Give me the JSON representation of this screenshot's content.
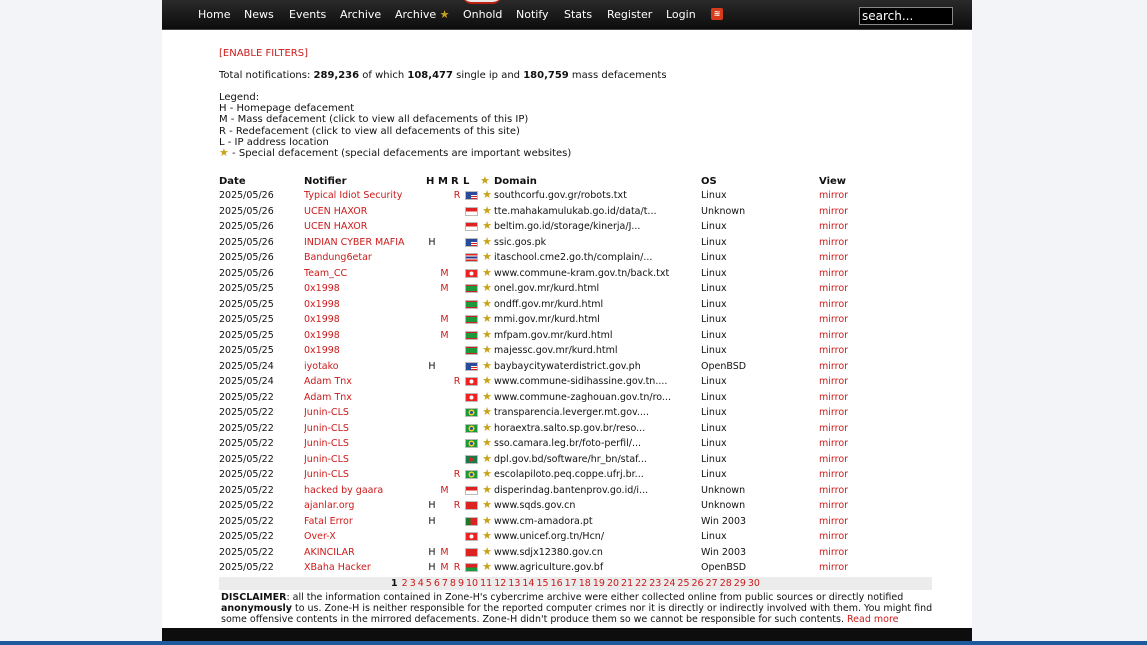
{
  "nav": {
    "items": [
      "Home",
      "News",
      "Events",
      "Archive",
      "Archive",
      "Onhold",
      "Notify",
      "Stats",
      "Register",
      "Login"
    ],
    "search_placeholder": "search...",
    "rss_icon": "rss-icon",
    "special_icon": "star-icon"
  },
  "filters_label": "[ENABLE FILTERS]",
  "totals": {
    "prefix": "Total notifications: ",
    "total": "289,236",
    "mid1": " of which ",
    "single": "108,477",
    "mid2": " single ip and ",
    "mass": "180,759",
    "suffix": " mass defacements"
  },
  "legend": {
    "title": "Legend:",
    "h": "H - Homepage defacement",
    "m": "M - Mass defacement (click to view all defacements of this IP)",
    "r": "R - Redefacement (click to view all defacements of this site)",
    "l": "L - IP address location",
    "star": " - Special defacement (special defacements are important websites)"
  },
  "table": {
    "headers": {
      "date": "Date",
      "notifier": "Notifier",
      "h": "H",
      "m": "M",
      "r": "R",
      "l": "L",
      "domain": "Domain",
      "os": "OS",
      "view": "View"
    },
    "rows": [
      {
        "date": "2025/05/26",
        "notifier": "Typical Idiot Security",
        "h": "",
        "m": "",
        "r": "R",
        "flag": "us",
        "domain": "southcorfu.gov.gr/robots.txt",
        "os": "Linux",
        "view": "mirror"
      },
      {
        "date": "2025/05/26",
        "notifier": "UCEN HAXOR",
        "h": "",
        "m": "",
        "r": "",
        "flag": "id",
        "domain": "tte.mahakamulukab.go.id/data/t...",
        "os": "Unknown",
        "view": "mirror"
      },
      {
        "date": "2025/05/26",
        "notifier": "UCEN HAXOR",
        "h": "",
        "m": "",
        "r": "",
        "flag": "id",
        "domain": "beltim.go.id/storage/kinerja/J...",
        "os": "Linux",
        "view": "mirror"
      },
      {
        "date": "2025/05/26",
        "notifier": "INDIAN CYBER MAFIA",
        "h": "H",
        "m": "",
        "r": "",
        "flag": "us",
        "domain": "ssic.gos.pk",
        "os": "Linux",
        "view": "mirror"
      },
      {
        "date": "2025/05/26",
        "notifier": "Bandung6etar",
        "h": "",
        "m": "",
        "r": "",
        "flag": "th",
        "domain": "itaschool.cme2.go.th/complain/...",
        "os": "Linux",
        "view": "mirror"
      },
      {
        "date": "2025/05/26",
        "notifier": "Team_CC",
        "h": "",
        "m": "M",
        "r": "",
        "flag": "tn",
        "domain": "www.commune-kram.gov.tn/back.txt",
        "os": "Linux",
        "view": "mirror"
      },
      {
        "date": "2025/05/25",
        "notifier": "0x1998",
        "h": "",
        "m": "M",
        "r": "",
        "flag": "mr",
        "domain": "onel.gov.mr/kurd.html",
        "os": "Linux",
        "view": "mirror"
      },
      {
        "date": "2025/05/25",
        "notifier": "0x1998",
        "h": "",
        "m": "",
        "r": "",
        "flag": "mr",
        "domain": "ondff.gov.mr/kurd.html",
        "os": "Linux",
        "view": "mirror"
      },
      {
        "date": "2025/05/25",
        "notifier": "0x1998",
        "h": "",
        "m": "M",
        "r": "",
        "flag": "mr",
        "domain": "mmi.gov.mr/kurd.html",
        "os": "Linux",
        "view": "mirror"
      },
      {
        "date": "2025/05/25",
        "notifier": "0x1998",
        "h": "",
        "m": "M",
        "r": "",
        "flag": "mr",
        "domain": "mfpam.gov.mr/kurd.html",
        "os": "Linux",
        "view": "mirror"
      },
      {
        "date": "2025/05/25",
        "notifier": "0x1998",
        "h": "",
        "m": "",
        "r": "",
        "flag": "mr",
        "domain": "majessc.gov.mr/kurd.html",
        "os": "Linux",
        "view": "mirror"
      },
      {
        "date": "2025/05/24",
        "notifier": "iyotako",
        "h": "H",
        "m": "",
        "r": "",
        "flag": "us",
        "domain": "baybaycitywaterdistrict.gov.ph",
        "os": "OpenBSD",
        "view": "mirror"
      },
      {
        "date": "2025/05/24",
        "notifier": "Adam Tnx",
        "h": "",
        "m": "",
        "r": "R",
        "flag": "tn",
        "domain": "www.commune-sidihassine.gov.tn....",
        "os": "Linux",
        "view": "mirror"
      },
      {
        "date": "2025/05/22",
        "notifier": "Adam Tnx",
        "h": "",
        "m": "",
        "r": "",
        "flag": "tn",
        "domain": "www.commune-zaghouan.gov.tn/ro...",
        "os": "Linux",
        "view": "mirror"
      },
      {
        "date": "2025/05/22",
        "notifier": "Junin-CLS",
        "h": "",
        "m": "",
        "r": "",
        "flag": "br",
        "domain": "transparencia.leverger.mt.gov....",
        "os": "Linux",
        "view": "mirror"
      },
      {
        "date": "2025/05/22",
        "notifier": "Junin-CLS",
        "h": "",
        "m": "",
        "r": "",
        "flag": "br",
        "domain": "horaextra.salto.sp.gov.br/reso...",
        "os": "Linux",
        "view": "mirror"
      },
      {
        "date": "2025/05/22",
        "notifier": "Junin-CLS",
        "h": "",
        "m": "",
        "r": "",
        "flag": "br",
        "domain": "sso.camara.leg.br/foto-perfil/...",
        "os": "Linux",
        "view": "mirror"
      },
      {
        "date": "2025/05/22",
        "notifier": "Junin-CLS",
        "h": "",
        "m": "",
        "r": "",
        "flag": "bd",
        "domain": "dpl.gov.bd/software/hr_bn/staf...",
        "os": "Linux",
        "view": "mirror"
      },
      {
        "date": "2025/05/22",
        "notifier": "Junin-CLS",
        "h": "",
        "m": "",
        "r": "R",
        "flag": "br",
        "domain": "escolapiloto.peq.coppe.ufrj.br...",
        "os": "Linux",
        "view": "mirror"
      },
      {
        "date": "2025/05/22",
        "notifier": "hacked by gaara",
        "h": "",
        "m": "M",
        "r": "",
        "flag": "id",
        "domain": "disperindag.bantenprov.go.id/i...",
        "os": "Unknown",
        "view": "mirror"
      },
      {
        "date": "2025/05/22",
        "notifier": "ajanlar.org",
        "h": "H",
        "m": "",
        "r": "R",
        "flag": "cn",
        "domain": "www.sqds.gov.cn",
        "os": "Unknown",
        "view": "mirror"
      },
      {
        "date": "2025/05/22",
        "notifier": "Fatal Error",
        "h": "H",
        "m": "",
        "r": "",
        "flag": "pt",
        "domain": "www.cm-amadora.pt",
        "os": "Win 2003",
        "view": "mirror"
      },
      {
        "date": "2025/05/22",
        "notifier": "Over-X",
        "h": "",
        "m": "",
        "r": "",
        "flag": "tn",
        "domain": "www.unicef.org.tn/Hcn/",
        "os": "Linux",
        "view": "mirror"
      },
      {
        "date": "2025/05/22",
        "notifier": "AKINCILAR",
        "h": "H",
        "m": "M",
        "r": "",
        "flag": "cn",
        "domain": "www.sdjx12380.gov.cn",
        "os": "Win 2003",
        "view": "mirror"
      },
      {
        "date": "2025/05/22",
        "notifier": "XBaha Hacker",
        "h": "H",
        "m": "M",
        "r": "R",
        "flag": "bf",
        "domain": "www.agriculture.gov.bf",
        "os": "OpenBSD",
        "view": "mirror"
      }
    ]
  },
  "pager": {
    "current": "1",
    "pages": [
      "2",
      "3",
      "4",
      "5",
      "6",
      "7",
      "8",
      "9",
      "10",
      "11",
      "12",
      "13",
      "14",
      "15",
      "16",
      "17",
      "18",
      "19",
      "20",
      "21",
      "22",
      "23",
      "24",
      "25",
      "26",
      "27",
      "28",
      "29",
      "30"
    ]
  },
  "disclaimer": {
    "label": "DISCLAIMER",
    "text1": ": all the information contained in Zone-H's cybercrime archive were either collected online from public sources or directly notified ",
    "bold": "anonymously",
    "text2": " to us. Zone-H is neither responsible for the reported computer crimes nor it is directly or indirectly involved with them. You might find some offensive contents in the mirrored defacements. Zone-H didn't produce them so we cannot be responsible for such contents. ",
    "read_more": "Read more"
  },
  "colors": {
    "link": "#cc1a1a",
    "topbar": "#111111",
    "background": "#f3f4f8",
    "footer_line": "#1d5a9c"
  }
}
